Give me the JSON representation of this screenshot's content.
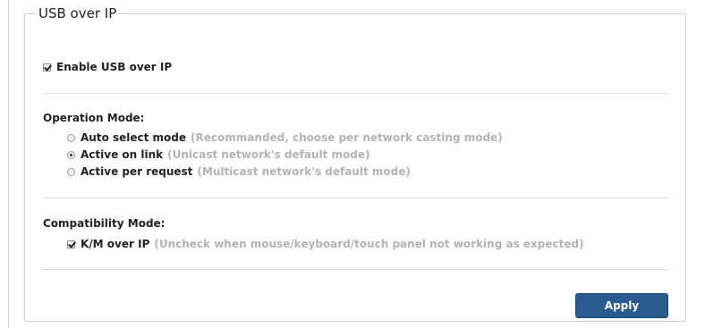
{
  "panel": {
    "title": "USB over IP"
  },
  "enable_usb": {
    "label": "Enable USB over IP",
    "checked": true
  },
  "operation_mode": {
    "title": "Operation Mode:",
    "options": [
      {
        "label": "Auto select mode",
        "hint": "(Recommanded, choose per network casting mode)",
        "selected": false
      },
      {
        "label": "Active on link",
        "hint": "(Unicast network's default mode)",
        "selected": true
      },
      {
        "label": "Active per request",
        "hint": "(Multicast network's default mode)",
        "selected": false
      }
    ]
  },
  "compatibility_mode": {
    "title": "Compatibility Mode:",
    "km_label": "K/M over IP",
    "km_hint": "(Uncheck when mouse/keyboard/touch panel not working as expected)",
    "km_checked": true
  },
  "actions": {
    "apply_label": "Apply"
  },
  "colors": {
    "apply_button": "#2a5b8f",
    "hint_text": "#b3b3b3",
    "border": "#cfcfcf"
  }
}
